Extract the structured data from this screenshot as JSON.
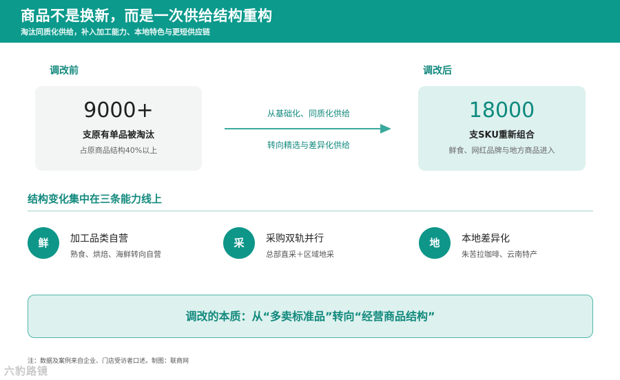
{
  "header": {
    "title": "商品不是换新，而是一次供给结构重构",
    "subtitle": "淘汰同质化供给，补入加工能力、本地特色与更短供应链"
  },
  "before": {
    "label": "调改前",
    "number": "9000+",
    "main": "支原有单品被淘汰",
    "sub": "占原商品结构40%以上"
  },
  "after": {
    "label": "调改后",
    "number": "18000",
    "main": "支SKU重新组合",
    "sub": "鲜食、网红品牌与地方商品进入"
  },
  "transition": {
    "from": "从基础化、同质化供给",
    "to": "转向精选与差异化供给"
  },
  "capabilities": {
    "title": "结构变化集中在三条能力线上",
    "items": [
      {
        "badge": "鲜",
        "title": "加工品类自营",
        "desc": "熟食、烘焙、海鲜转向自营"
      },
      {
        "badge": "采",
        "title": "采购双轨并行",
        "desc": "总部直采＋区域地采"
      },
      {
        "badge": "地",
        "title": "本地差异化",
        "desc": "朱苦拉咖啡、云南特产"
      }
    ]
  },
  "essence": "调改的本质：从“多卖标准品”转向“经营商品结构”",
  "footnote": "注：数据及案例来自企业、门店受访者口述。制图：联商网",
  "watermark": "六豹路镜",
  "colors": {
    "accent": "#0b9a8c",
    "accent_text": "#12897d",
    "light_teal": "#ddf1ee",
    "card_grey": "#f3f4f4"
  }
}
